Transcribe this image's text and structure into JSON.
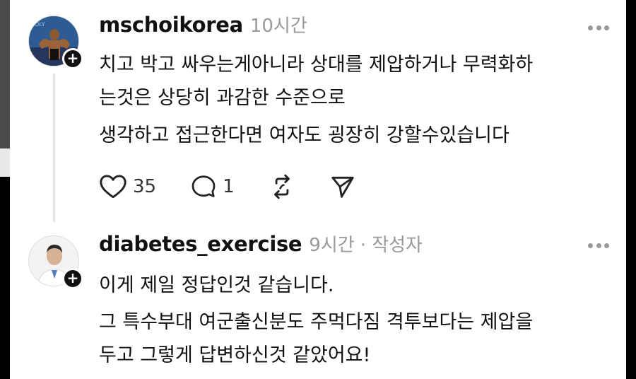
{
  "posts": [
    {
      "username": "mschoikorea",
      "time": "10시간",
      "author_tag": "",
      "lines": [
        "치고 박고 싸우는게아니라 상대를 제압하거나 무력화하",
        "는것은 상당히 과감한 수준으로",
        "생각하고 접근한다면 여자도 굉장히 강할수있습니다"
      ],
      "likes": "35",
      "replies": "1"
    },
    {
      "username": "diabetes_exercise",
      "time": "9시간",
      "author_tag": "· 작성자",
      "lines": [
        "이게 제일 정답인것 같습니다.",
        "그 특수부대 여군출신분도 주먹다짐 격투보다는 제압을",
        "두고 그렇게 답변하신것 같았어요!"
      ]
    }
  ],
  "icons": {
    "like": "heart-icon",
    "reply": "comment-icon",
    "repost": "repost-icon",
    "share": "send-icon",
    "follow": "plus-icon",
    "more": "more-icon"
  }
}
